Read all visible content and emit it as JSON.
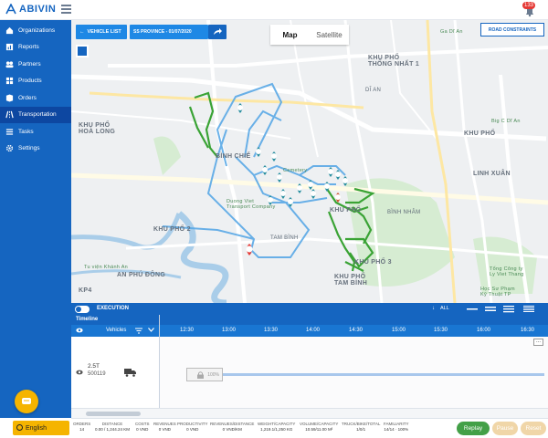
{
  "app": {
    "brand": "ABIVIN",
    "notification_count": "133"
  },
  "sidebar": {
    "items": [
      {
        "label": "Organizations",
        "icon": "home-icon",
        "active": false
      },
      {
        "label": "Reports",
        "icon": "report-icon",
        "active": false
      },
      {
        "label": "Partners",
        "icon": "partners-icon",
        "active": false
      },
      {
        "label": "Products",
        "icon": "products-icon",
        "active": false
      },
      {
        "label": "Orders",
        "icon": "orders-icon",
        "active": false
      },
      {
        "label": "Transportation",
        "icon": "road-icon",
        "active": true
      },
      {
        "label": "Tasks",
        "icon": "tasks-icon",
        "active": false
      },
      {
        "label": "Settings",
        "icon": "gear-icon",
        "active": false
      }
    ],
    "language": "English"
  },
  "map": {
    "vehicle_list_label": "VEHICLE LIST",
    "province_label": "SS PROVINCE - 01/07/2020",
    "map_type": {
      "map": "Map",
      "satellite": "Satellite",
      "selected": "Map"
    },
    "road_constraints_label": "ROAD CONSTRAINTS",
    "labels": {
      "khu_pho_thong_nhat": "KHU PHỐ\nTHỐNG NHẤT 1",
      "khu_pho_hoa_long": "KHU PHỐ\nHOÀ LONG",
      "binh_chieu": "BÌNH CHIỂ",
      "khu_pho_top_right": "KHU PHỐ",
      "khu_pho_3": "KHU PHỐ 3",
      "khu_pho_tam_binh": "KHU PHỐ\nTAM BÌNH",
      "khu_pho_2": "KHU PHỐ 2",
      "an_phu_dong": "AN PHÚ ĐÔNG",
      "kp4": "KP4",
      "linh_xuan": "LINH XUÂN",
      "binh_nham": "BÌNH NHÂM",
      "di_an": "DĨ AN",
      "an_binh": "AN BÌNH",
      "tam_binh": "TAM BÌNH",
      "cemetery": "Cemetery",
      "duong_viet_transport": "Duong Viet\nTransport Company",
      "tu_vien_khanh_an": "Tu viện Khánh An",
      "tong_cong_ty": "Tổng Công ty\nLy Viet Thang",
      "hoc_su_pham": "Học Sư Phạm\nKỹ Thuật TP",
      "ga_di_an": "Ga Dĩ An",
      "big_c": "Big C Dĩ An",
      "bcp_university": "Trường ĐH Sư phạm"
    }
  },
  "execution": {
    "title": "EXECUTION",
    "filter_label": "ALL",
    "timeline_label": "Timeline",
    "vehicles_label": "Vehicles",
    "ticks": [
      "12:30",
      "13:00",
      "13:30",
      "14:00",
      "14:30",
      "15:00",
      "15:30",
      "16:00",
      "16:30"
    ],
    "more_label": "...",
    "vehicle": {
      "capacity": "2.5T",
      "code": "500119"
    },
    "route_progress": "100%"
  },
  "footer": {
    "metrics": [
      {
        "label": "ORDERS",
        "value": "14"
      },
      {
        "label": "DISTANCE",
        "value": "0.00 / 1,244.24 KM"
      },
      {
        "label": "COSTS",
        "value": "0 VND"
      },
      {
        "label": "REVENUES",
        "value": "0 VND"
      },
      {
        "label": "PRODUCTIVITY",
        "value": "0 VND"
      },
      {
        "label": "REVENUES/DISTANCE",
        "value": "0 VND/KM"
      },
      {
        "label": "WEIGHT/CAPACITY",
        "value": "1,219.1/1,250 KG"
      },
      {
        "label": "VOLUME/CAPACITY",
        "value": "10.59/11.00 M³"
      },
      {
        "label": "TRUCK/BIKE/TOTAL",
        "value": "1/0/1"
      },
      {
        "label": "FAMILIARITY",
        "value": "14/14 · 100%"
      }
    ],
    "replay_label": "Replay",
    "pause_label": "Pause",
    "reset_label": "Reset"
  },
  "colors": {
    "sidebar": "#1565c0",
    "sidebar_active": "#0d47a1",
    "accent_yellow": "#f5b400",
    "route_green": "#3aa335",
    "pin_teal": "#2b8fa0",
    "replay_green": "#43a047"
  }
}
